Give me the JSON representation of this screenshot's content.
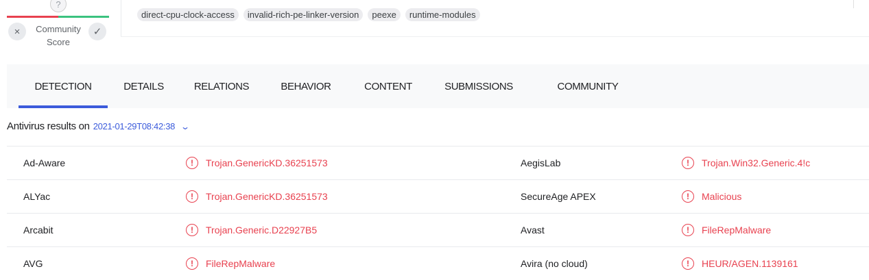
{
  "community_score": {
    "unknown_symbol": "?",
    "label_line1": "Community",
    "label_line2": "Score",
    "vote_down_icon": "×",
    "vote_up_icon": "✓",
    "bar_colors": {
      "malicious": "#e8414f",
      "harmless": "#3ac27f"
    }
  },
  "tags": [
    "direct-cpu-clock-access",
    "invalid-rich-pe-linker-version",
    "peexe",
    "runtime-modules"
  ],
  "tabs": [
    {
      "label": "DETECTION",
      "active": true
    },
    {
      "label": "DETAILS",
      "active": false
    },
    {
      "label": "RELATIONS",
      "active": false
    },
    {
      "label": "BEHAVIOR",
      "active": false
    },
    {
      "label": "CONTENT",
      "active": false
    },
    {
      "label": "SUBMISSIONS",
      "active": false
    },
    {
      "label": "COMMUNITY",
      "active": false
    }
  ],
  "antivirus": {
    "heading": "Antivirus results on",
    "date": "2021-01-29T08:42:38",
    "rows": [
      {
        "engine1": "Ad-Aware",
        "result1": "Trojan.GenericKD.36251573",
        "engine2": "AegisLab",
        "result2": "Trojan.Win32.Generic.4!c"
      },
      {
        "engine1": "ALYac",
        "result1": "Trojan.GenericKD.36251573",
        "engine2": "SecureAge APEX",
        "result2": "Malicious"
      },
      {
        "engine1": "Arcabit",
        "result1": "Trojan.Generic.D22927B5",
        "engine2": "Avast",
        "result2": "FileRepMalware"
      },
      {
        "engine1": "AVG",
        "result1": "FileRepMalware",
        "engine2": "Avira (no cloud)",
        "result2": "HEUR/AGEN.1139161"
      }
    ]
  },
  "colors": {
    "accent": "#3b5bdb",
    "malicious": "#e8414f"
  }
}
